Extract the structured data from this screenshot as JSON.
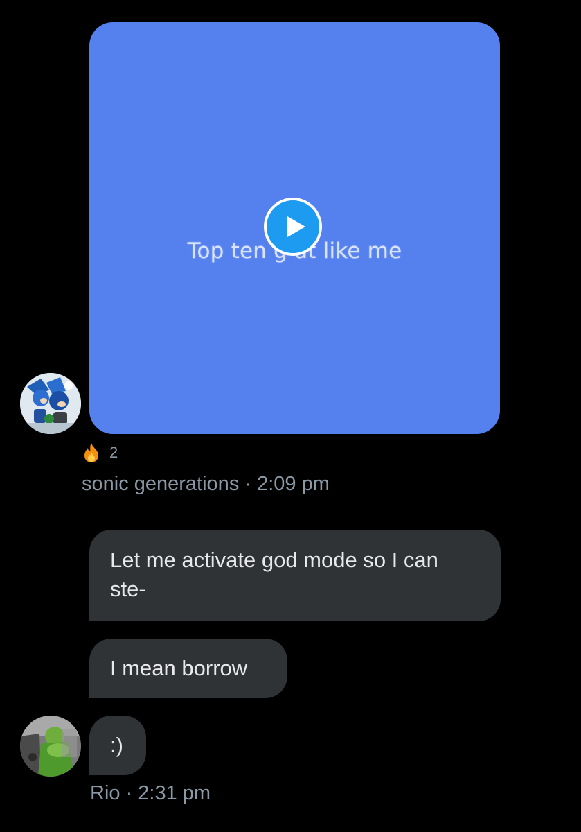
{
  "video_message": {
    "caption_visible": "Top ten g      at like me",
    "play_icon": "play-icon",
    "background_color": "#5581ef"
  },
  "reaction": {
    "emoji": "fire-icon",
    "count": "2"
  },
  "sender_1": {
    "name": "sonic generations",
    "separator": "·",
    "time": "2:09 pm",
    "meta": "sonic generations · 2:09 pm"
  },
  "messages": [
    {
      "text": "Let me activate god mode so I can ste-"
    },
    {
      "text": "I mean borrow"
    },
    {
      "text": ":)"
    }
  ],
  "sender_2": {
    "name": "Rio",
    "time": "2:31 pm",
    "meta": "Rio · 2:31 pm"
  },
  "colors": {
    "background": "#000000",
    "bubble": "#2f3336",
    "text": "#e7e9ea",
    "muted": "#8b98a5",
    "play_button": "#1d9bf0"
  }
}
